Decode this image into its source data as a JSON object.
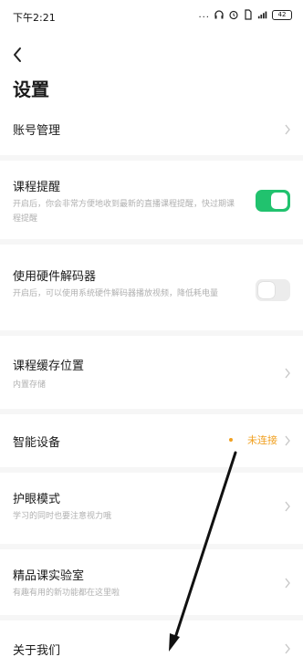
{
  "status_bar": {
    "time": "下午2:21",
    "dots": "...",
    "battery": "42"
  },
  "header": {
    "title": "设置"
  },
  "items": [
    {
      "title": "账号管理"
    },
    {
      "title": "课程提醒",
      "subtitle": "开启后，你会非常方便地收到最新的直播课程提醒，快过期课程提醒",
      "toggle": true
    },
    {
      "title": "使用硬件解码器",
      "subtitle": "开启后，可以使用系统硬件解码器播放视频，降低耗电量",
      "toggle": false
    },
    {
      "title": "课程缓存位置",
      "subtitle": "内置存储"
    },
    {
      "title": "智能设备",
      "status": "未连接"
    },
    {
      "title": "护眼模式",
      "subtitle": "学习的同时也要注意视力哦"
    },
    {
      "title": "精品课实验室",
      "subtitle": "有趣有用的新功能都在这里啦"
    },
    {
      "title": "关于我们"
    }
  ],
  "colors": {
    "toggle_on": "#21c26e",
    "toggle_off": "#ececec",
    "status_orange": "#f0a020"
  }
}
